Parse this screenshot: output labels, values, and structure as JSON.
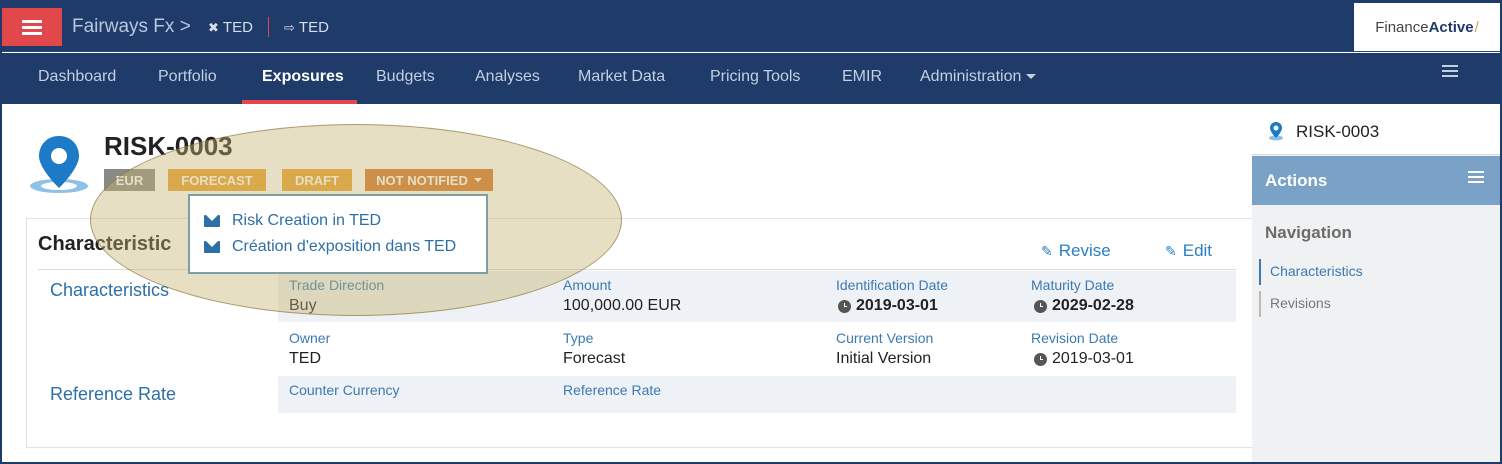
{
  "app": {
    "title": "Fairways Fx",
    "title_chevron": ">",
    "crumb_1": "TED",
    "crumb_2": "TED",
    "logo_regular": "Finance",
    "logo_bold": "Active",
    "logo_slash": "/"
  },
  "nav": {
    "items": [
      {
        "label": "Dashboard"
      },
      {
        "label": "Portfolio"
      },
      {
        "label": "Exposures",
        "active": true
      },
      {
        "label": "Budgets"
      },
      {
        "label": "Analyses"
      },
      {
        "label": "Market Data"
      },
      {
        "label": "Pricing Tools"
      },
      {
        "label": "EMIR"
      },
      {
        "label": "Administration"
      }
    ]
  },
  "risk": {
    "id": "RISK-0003",
    "badges": {
      "currency": "EUR",
      "type": "FORECAST",
      "status": "DRAFT",
      "notification": "NOT NOTIFIED"
    }
  },
  "dropdown": {
    "items": [
      {
        "label": "Risk Creation in TED"
      },
      {
        "label": "Création d'exposition dans TED"
      }
    ]
  },
  "panel": {
    "title": "Characteristic",
    "revise_label": "Revise",
    "edit_label": "Edit",
    "section_characteristics": "Characteristics",
    "section_reference_rate": "Reference Rate",
    "fields": {
      "trade_direction": {
        "label": "Trade Direction",
        "value": "Buy"
      },
      "amount": {
        "label": "Amount",
        "value": "100,000.00 EUR"
      },
      "identification_date": {
        "label": "Identification Date",
        "value": "2019-03-01"
      },
      "maturity_date": {
        "label": "Maturity Date",
        "value": "2029-02-28"
      },
      "owner": {
        "label": "Owner",
        "value": "TED"
      },
      "type": {
        "label": "Type",
        "value": "Forecast"
      },
      "current_version": {
        "label": "Current Version",
        "value": "Initial Version"
      },
      "revision_date": {
        "label": "Revision Date",
        "value": "2019-03-01"
      },
      "counter_currency": {
        "label": "Counter Currency",
        "value": ""
      },
      "reference_rate": {
        "label": "Reference Rate",
        "value": ""
      }
    }
  },
  "sidebar": {
    "risk_id": "RISK-0003",
    "actions_label": "Actions",
    "navigation_title": "Navigation",
    "nav_items": [
      {
        "label": "Characteristics",
        "active": true
      },
      {
        "label": "Revisions",
        "active": false
      }
    ]
  },
  "colors": {
    "navy": "#1e3b6a",
    "accent_red": "#e2474b",
    "badge_grey": "#8a8a85",
    "badge_orange": "#eba332",
    "badge_dark_orange": "#d6752b",
    "link_blue": "#2d6fa6",
    "actions_bar": "#7aa2c6"
  }
}
